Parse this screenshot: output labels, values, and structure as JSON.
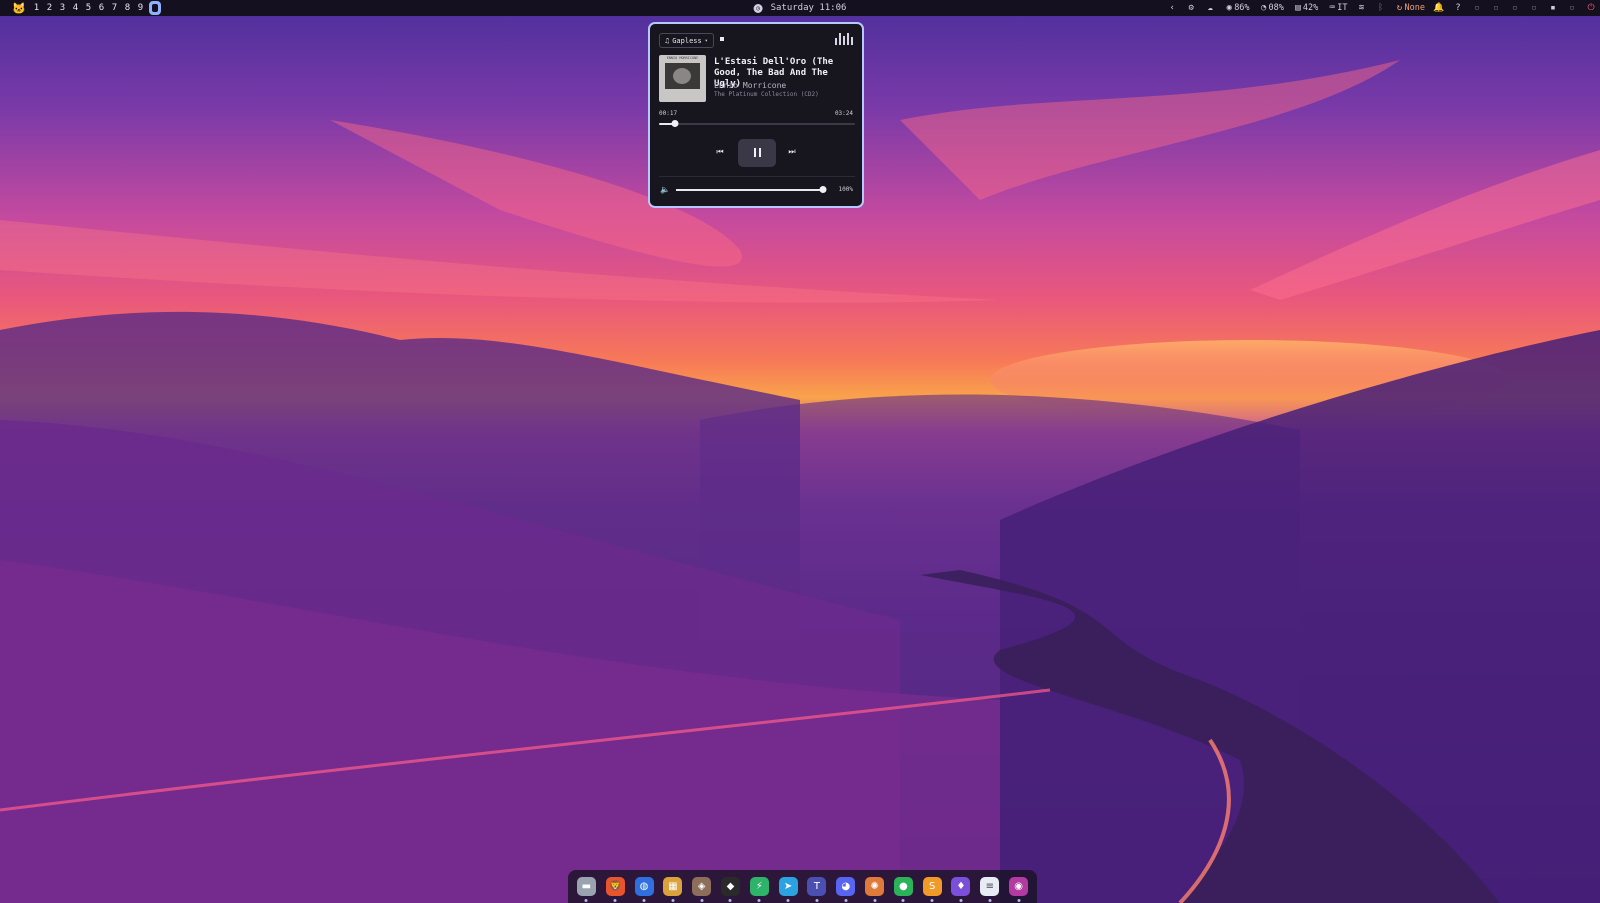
{
  "topbar": {
    "workspaces": [
      "1",
      "2",
      "3",
      "4",
      "5",
      "6",
      "7",
      "8",
      "9"
    ],
    "active_workspace_index": 9,
    "clock": "Saturday 11:06",
    "status": {
      "cpu": "86%",
      "mem": "08%",
      "disk": "42%",
      "keyboard": "IT",
      "network": "None"
    }
  },
  "player": {
    "gapless_label": "Gapless",
    "track_title": "L'Estasi Dell'Oro (The Good, The Bad And The Ugly)",
    "artist": "Ennio Morricone",
    "album": "The Platinum Collection (CD2)",
    "cover_text": "ENNIO MORRICONE",
    "time_current": "00:17",
    "time_total": "03:24",
    "progress_fraction": 0.083,
    "volume_label": "100%",
    "volume_fraction": 0.99
  },
  "dock": {
    "apps": [
      {
        "name": "files",
        "icon": "folder-icon",
        "color": "#9aa3b0"
      },
      {
        "name": "brave",
        "icon": "lion-icon",
        "color": "#e8542c"
      },
      {
        "name": "browser",
        "icon": "globe-icon",
        "color": "#2f6fe0"
      },
      {
        "name": "archive",
        "icon": "box-icon",
        "color": "#d9a23c"
      },
      {
        "name": "games",
        "icon": "gamepad-icon",
        "color": "#8c6e5a"
      },
      {
        "name": "cube",
        "icon": "cube-icon",
        "color": "#2a2a2a"
      },
      {
        "name": "bolt",
        "icon": "bolt-icon",
        "color": "#2db36a"
      },
      {
        "name": "telegram",
        "icon": "paper-plane-icon",
        "color": "#2aa3e0"
      },
      {
        "name": "typora",
        "icon": "text-icon",
        "color": "#4a4fb0"
      },
      {
        "name": "discord",
        "icon": "discord-icon",
        "color": "#5865f2"
      },
      {
        "name": "claude",
        "icon": "spark-icon",
        "color": "#e07a3a"
      },
      {
        "name": "spotify",
        "icon": "music-circle-icon",
        "color": "#2bb35a"
      },
      {
        "name": "sublime",
        "icon": "s-icon",
        "color": "#f09a28"
      },
      {
        "name": "obsidian",
        "icon": "crystal-icon",
        "color": "#7b4fd8"
      },
      {
        "name": "document",
        "icon": "document-icon",
        "color": "#e8ecf4"
      },
      {
        "name": "media",
        "icon": "disc-icon",
        "color": "#b23aa0"
      }
    ]
  }
}
